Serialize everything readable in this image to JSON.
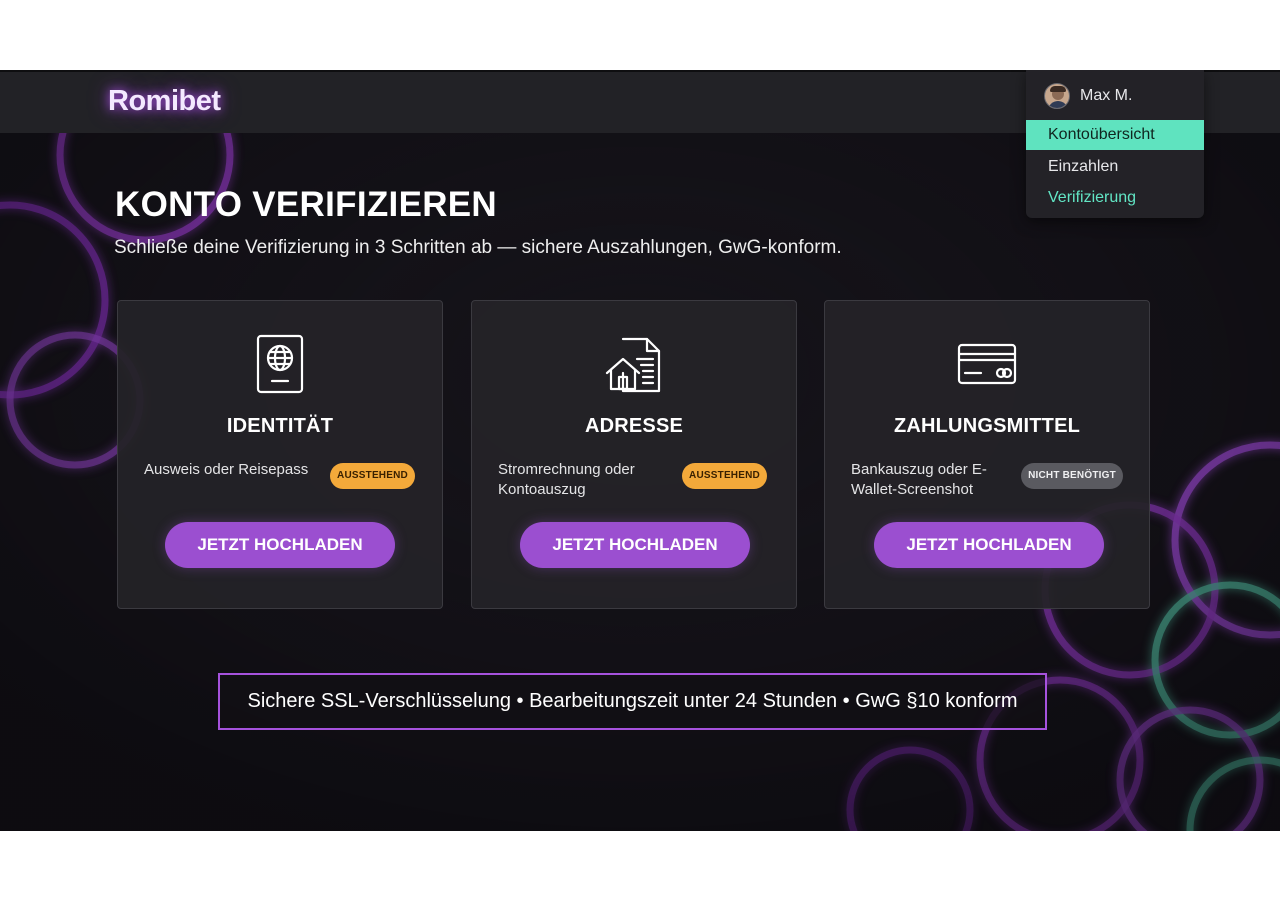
{
  "brand": {
    "logo": "Romibet",
    "accent": "#9b4fd0",
    "mint": "#5fe3bf"
  },
  "user": {
    "name": "Max M.",
    "menu": [
      {
        "label": "Kontoübersicht",
        "state": "highlighted"
      },
      {
        "label": "Einzahlen",
        "state": "normal"
      },
      {
        "label": "Verifizierung",
        "state": "current"
      }
    ]
  },
  "page": {
    "title": "KONTO VERIFIZIEREN",
    "subtitle": "Schließe deine Verifizierung in 3 Schritten ab — sichere Auszahlungen, GwG-konform."
  },
  "cards": [
    {
      "icon": "passport-icon",
      "title": "IDENTITÄT",
      "description": "Ausweis oder Reisepass",
      "status": "AUSSTEHEND",
      "status_color": "#f3a93a",
      "button": "JETZT HOCHLADEN"
    },
    {
      "icon": "address-document-icon",
      "title": "ADRESSE",
      "description": "Stromrechnung oder Kontoauszug",
      "status": "AUSSTEHEND",
      "status_color": "#f3a93a",
      "button": "JETZT HOCHLADEN"
    },
    {
      "icon": "payment-card-icon",
      "title": "ZAHLUNGSMITTEL",
      "description": "Bankauszug oder E-Wallet-Screenshot",
      "status": "NICHT BENÖTIGT",
      "status_color": "#5a5a60",
      "button": "JETZT HOCHLADEN"
    }
  ],
  "footer_note": "Sichere SSL-Verschlüsselung • Bearbeitungszeit unter 24 Stunden • GwG §10 konform"
}
